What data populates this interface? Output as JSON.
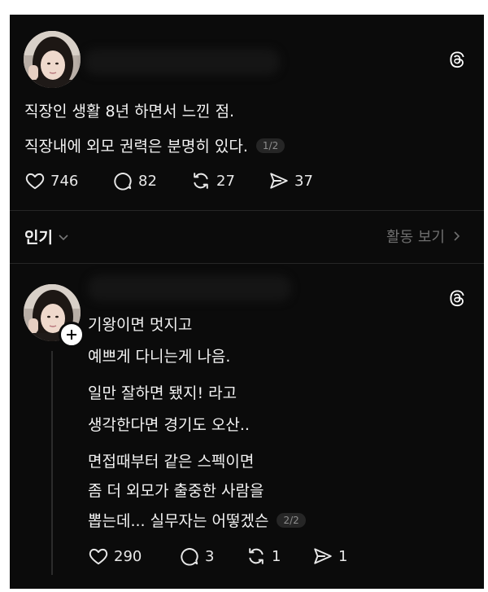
{
  "post": {
    "line1": "직장인 생활 8년 하면서 느낀 점.",
    "line2": "직장내에 외모 권력은 분명히 있다.",
    "pager": "1/2",
    "likes": "746",
    "comments": "82",
    "reposts": "27",
    "shares": "37"
  },
  "sort": {
    "label": "인기",
    "activity": "활동 보기"
  },
  "reply": {
    "p1_l1": "기왕이면 멋지고",
    "p1_l2": "예쁘게 다니는게 나음.",
    "p2_l1": "일만 잘하면 됐지! 라고",
    "p2_l2": "생각한다면 경기도 오산..",
    "p3_l1": "면접때부터 같은 스펙이면",
    "p3_l2": "좀 더 외모가 출중한 사람을",
    "p3_l3": "뽑는데... 실무자는 어떻겠슨",
    "pager": "2/2",
    "likes": "290",
    "comments": "3",
    "reposts": "1",
    "shares": "1"
  },
  "icons": {
    "threads": "threads-logo-icon",
    "like": "heart-icon",
    "comment": "comment-bubble-icon",
    "repost": "repost-icon",
    "share": "send-icon",
    "chevron_down": "chevron-down-icon",
    "chevron_right": "chevron-right-icon",
    "follow": "plus-icon"
  },
  "colors": {
    "background": "#0b0b0b",
    "text": "#f3f3f3",
    "muted": "#777777"
  }
}
